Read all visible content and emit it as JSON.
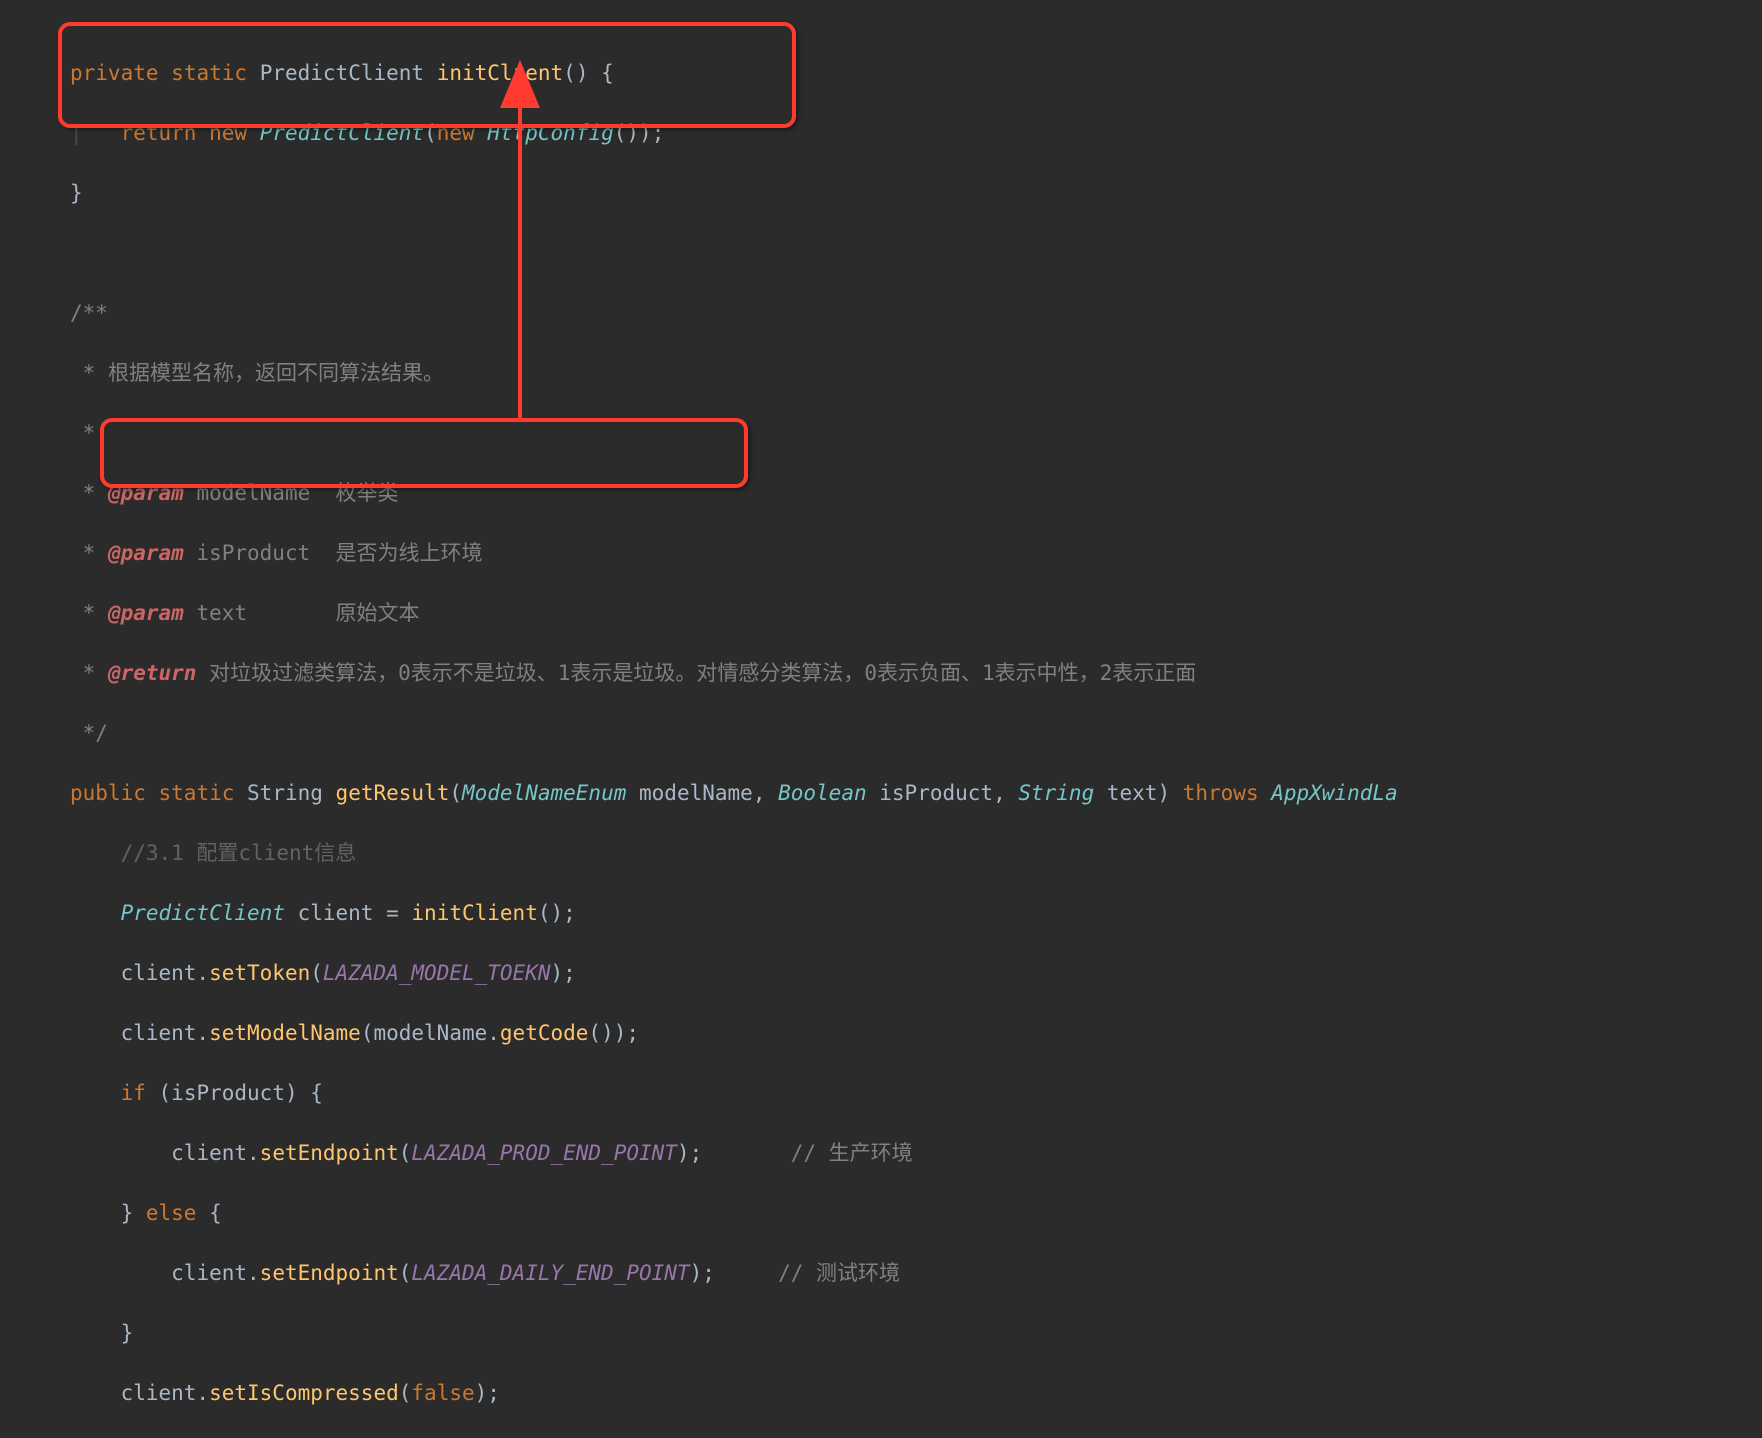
{
  "code": {
    "l1": {
      "kw_private": "private",
      "kw_static": "static",
      "type": "PredictClient",
      "method": "initClient",
      "paren_open": "(",
      "paren_close": ")",
      "brace": " {"
    },
    "l2": {
      "kw_return": "return",
      "kw_new1": "new",
      "type1": "PredictClient",
      "open1": "(",
      "kw_new2": "new",
      "type2": "HttpConfig",
      "tail": "());"
    },
    "l3": {
      "brace": "}"
    },
    "l5": {
      "open": "/**"
    },
    "l6": {
      "star": " *",
      "text": " 根据模型名称，返回不同算法结果。"
    },
    "l7": {
      "star": " *"
    },
    "l8": {
      "star": " * ",
      "tag": "@param",
      "name": " modelName",
      "desc": "  枚举类"
    },
    "l9": {
      "star": " * ",
      "tag": "@param",
      "name": " isProduct",
      "desc": "  是否为线上环境"
    },
    "l10": {
      "star": " * ",
      "tag": "@param",
      "name": " text     ",
      "desc": "  原始文本"
    },
    "l11": {
      "star": " * ",
      "tag": "@return",
      "desc": " 对垃圾过滤类算法，0表示不是垃圾、1表示是垃圾。对情感分类算法，0表示负面、1表示中性，2表示正面"
    },
    "l12": {
      "close": " */"
    },
    "l13": {
      "kw_public": "public",
      "kw_static": "static",
      "ret_type": "String",
      "method": "getResult",
      "open": "(",
      "p1t": "ModelNameEnum",
      "p1n": " modelName",
      "c1": ", ",
      "p2t": "Boolean",
      "p2n": " isProduct",
      "c2": ", ",
      "p3t": "String",
      "p3n": " text",
      "close": ") ",
      "kw_throws": "throws",
      "ex": " AppXwindLa"
    },
    "l14": {
      "comment": "//3.1 配置client信息"
    },
    "l15": {
      "type": "PredictClient",
      "var": " client ",
      "eq": "= ",
      "call": "initClient",
      "tail": "();"
    },
    "l16": {
      "obj": "client.",
      "method": "setToken",
      "open": "(",
      "arg": "LAZADA_MODEL_TOEKN",
      "close": ");"
    },
    "l17": {
      "obj": "client.",
      "method": "setModelName",
      "open": "(",
      "arg1": "modelName.",
      "inner": "getCode",
      "close": "());"
    },
    "l18": {
      "kw_if": "if",
      "open": " (",
      "cond": "isProduct",
      "close": ") {"
    },
    "l19": {
      "obj": "client.",
      "method": "setEndpoint",
      "open": "(",
      "arg": "LAZADA_PROD_END_POINT",
      "close": ");",
      "pad": "       ",
      "comment": "// 生产环境"
    },
    "l20": {
      "close_brace": "}",
      "kw_else": " else ",
      "open_brace": "{"
    },
    "l21": {
      "obj": "client.",
      "method": "setEndpoint",
      "open": "(",
      "arg": "LAZADA_DAILY_END_POINT",
      "close": ");",
      "pad": "     ",
      "comment": "// 测试环境"
    },
    "l22": {
      "brace": "}"
    },
    "l23": {
      "obj": "client.",
      "method": "setIsCompressed",
      "open": "(",
      "arg": "false",
      "close": ");"
    }
  }
}
